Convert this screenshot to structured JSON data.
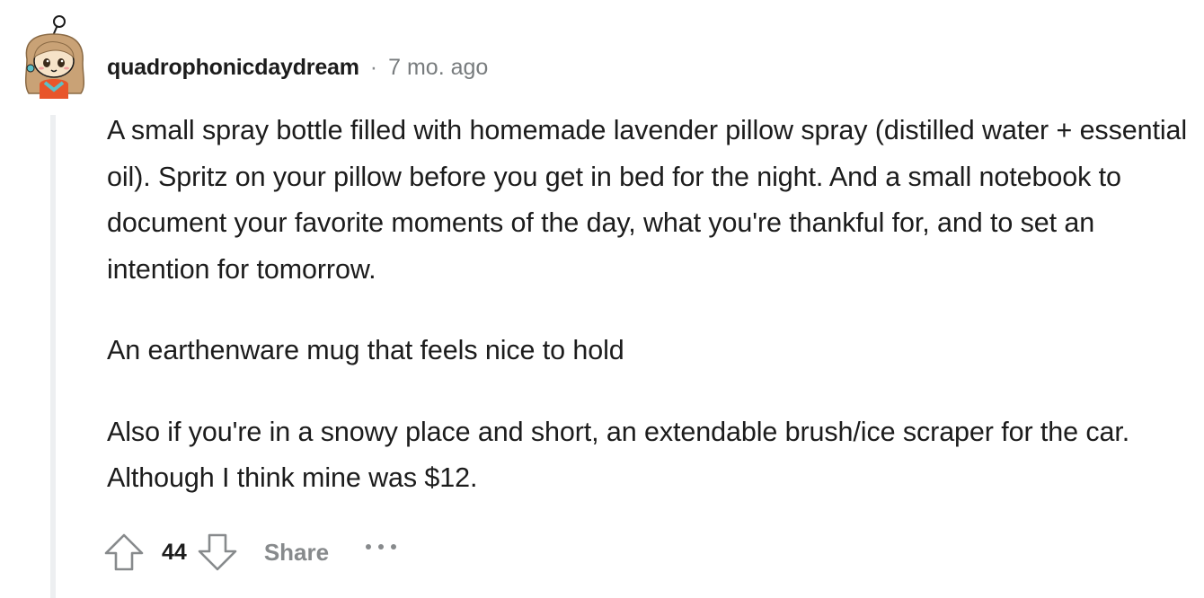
{
  "comment": {
    "author": "quadrophonicdaydream",
    "separator": "·",
    "timestamp": "7 mo. ago",
    "paragraphs": [
      "A small spray bottle filled with homemade lavender pillow spray (distilled water + essential oil). Spritz on your pillow before you get in bed for the night. And a small notebook to document your favorite moments of the day, what you're thankful for, and to set an intention for tomorrow.",
      "An earthenware mug that feels nice to hold",
      "Also if you're in a snowy place and short, an extendable brush/ice scraper for the car. Although I think mine was $12."
    ],
    "actions": {
      "score": "44",
      "share_label": "Share",
      "more_label": "..."
    }
  },
  "colors": {
    "text": "#1c1c1c",
    "meta": "#787c7e",
    "action": "#878a8c",
    "thread_line": "#edeff1",
    "avatar_hair": "#c9a276",
    "avatar_shirt": "#e8552a"
  },
  "icons": {
    "avatar": "snoo-avatar-icon",
    "upvote": "upvote-arrow-icon",
    "downvote": "downvote-arrow-icon",
    "more": "more-dots-icon"
  }
}
